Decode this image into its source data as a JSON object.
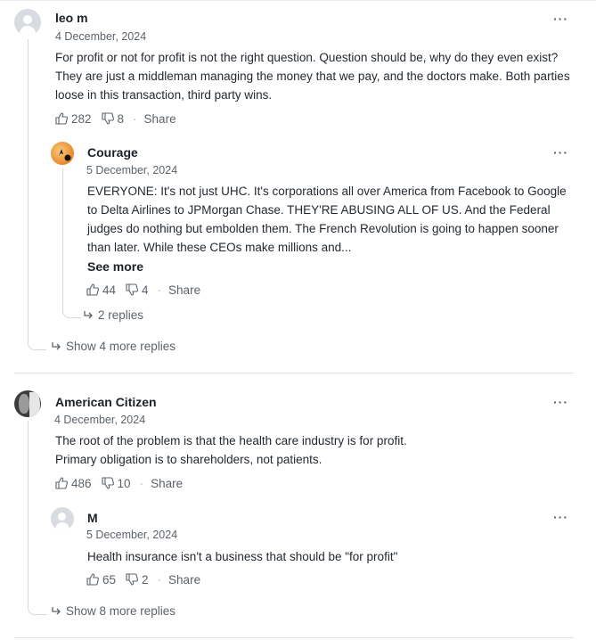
{
  "comments": [
    {
      "author": "leo m",
      "date": "4 December, 2024",
      "text": "For profit or not for profit is not the right question. Question should be, why do they even exist? They are just a middleman managing the money that we pay, and the doctors make. Both parties loose in this transaction, third party wins.",
      "likes": "282",
      "dislikes": "8",
      "share_label": "Share",
      "more_label": "···",
      "reply": {
        "author": "Courage",
        "date": "5 December, 2024",
        "text": "EVERYONE: It's not just UHC. It's corporations all over America from Facebook to Google to Delta Airlines to JPMorgan Chase. THEY'RE ABUSING ALL OF US. And the Federal judges do nothing but embolden them. The French Revolution is going to happen sooner than later. While these CEOs make millions and...",
        "see_more_label": "See more",
        "likes": "44",
        "dislikes": "4",
        "share_label": "Share",
        "more_label": "···",
        "replies_label": "2 replies"
      },
      "show_more_label": "Show 4 more replies"
    },
    {
      "author": "American Citizen",
      "date": "4 December, 2024",
      "text_line1": "The root of the problem is that the health care industry is for profit.",
      "text_line2": "Primary obligation is to shareholders, not patients.",
      "likes": "486",
      "dislikes": "10",
      "share_label": "Share",
      "more_label": "···",
      "reply": {
        "author": "M",
        "date": "5 December, 2024",
        "text": "Health insurance isn't a business that should be \"for profit\"",
        "likes": "65",
        "dislikes": "2",
        "share_label": "Share",
        "more_label": "···"
      },
      "show_more_label": "Show 8 more replies"
    }
  ],
  "icons": {
    "like": "thumbs-up-icon",
    "dislike": "thumbs-down-icon",
    "reply_arrow": "reply-arrow-icon",
    "more": "more-options-icon"
  },
  "colors": {
    "text": "#232a31",
    "muted": "#5b636a",
    "thread_line": "#d5d9de"
  }
}
